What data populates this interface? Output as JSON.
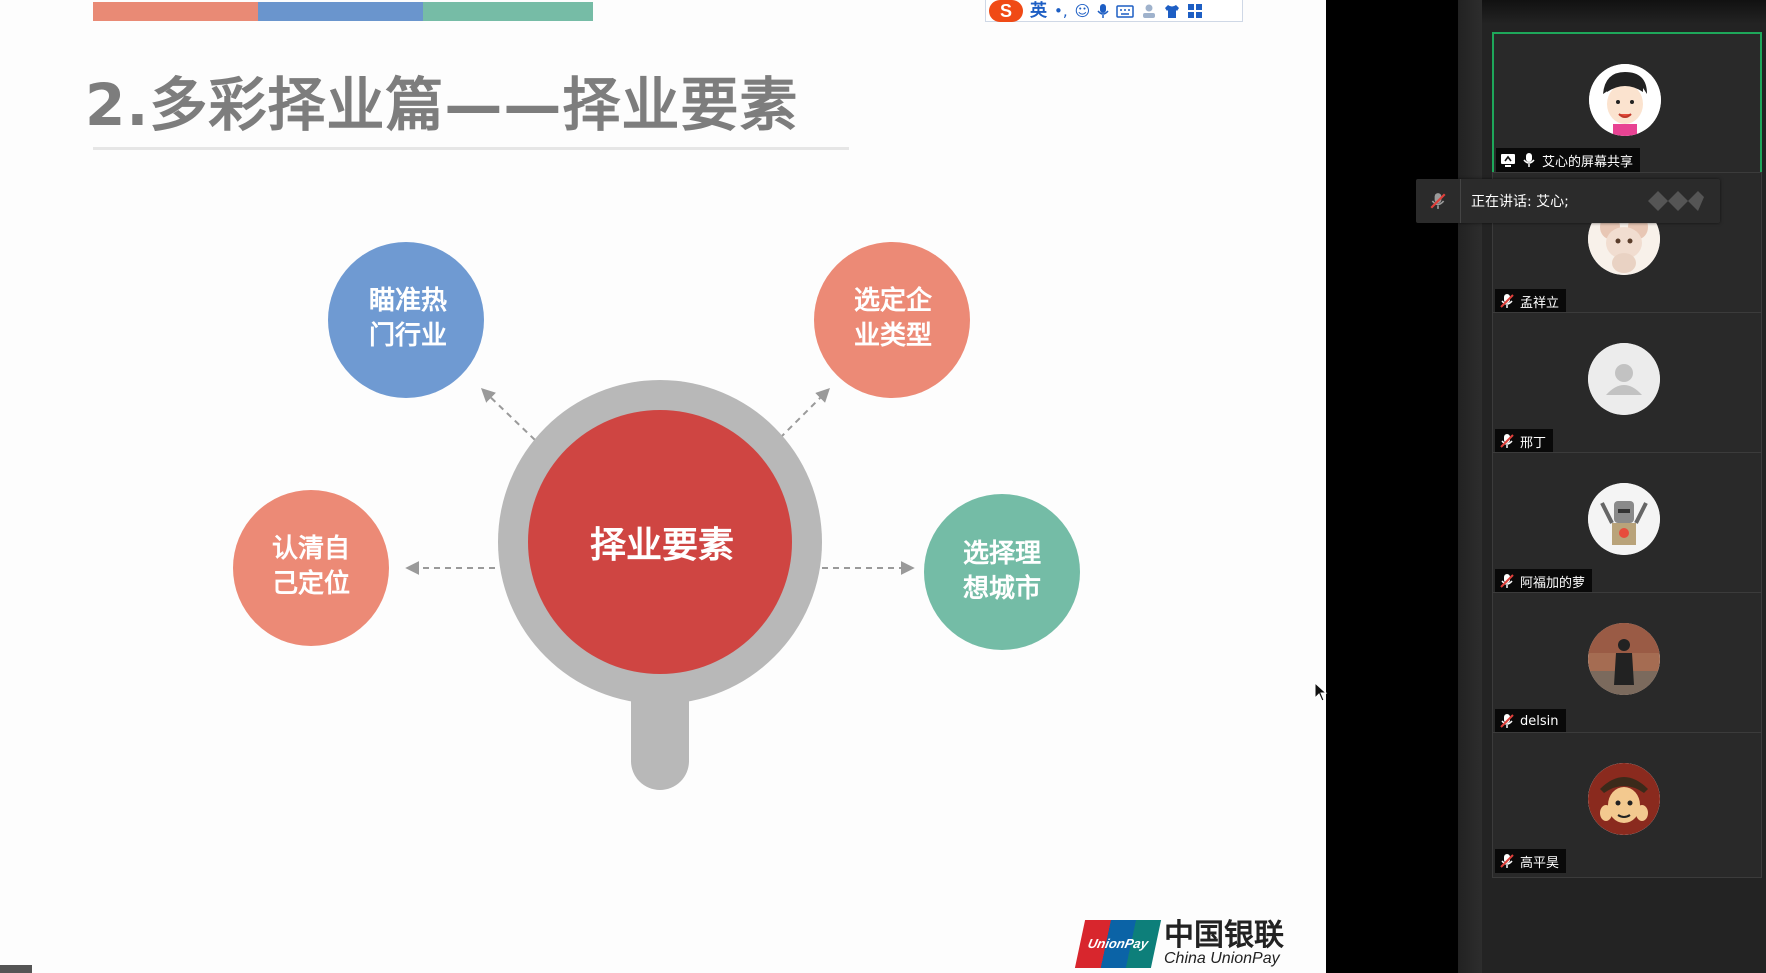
{
  "slide": {
    "title": "2.多彩择业篇——择业要素",
    "center_label": "择业要素",
    "nodes": {
      "top_left": [
        "瞄准热",
        "门行业"
      ],
      "top_right": [
        "选定企",
        "业类型"
      ],
      "left": [
        "认清自",
        "己定位"
      ],
      "right": [
        "选择理",
        "想城市"
      ]
    },
    "colors": {
      "blue": "#6f9ad2",
      "salmon": "#ec8a76",
      "teal": "#74bca6",
      "red": "#cf4542",
      "gray": "#b8b8b8"
    }
  },
  "ime_toolbar": {
    "logo": "S",
    "lang": "英",
    "punct": "•,",
    "icons": [
      "smiley-icon",
      "mic-icon",
      "keyboard-icon",
      "user-icon",
      "shirt-icon",
      "grid-icon"
    ]
  },
  "brand": {
    "badge_text": "UnionPay 银联",
    "cn": "中国银联",
    "en": "China UnionPay"
  },
  "speaker_banner": {
    "text": "正在讲话: 艾心;"
  },
  "participants": [
    {
      "name": "艾心的屏幕共享",
      "active": true,
      "icon": "screen-share-icon",
      "mic": "on"
    },
    {
      "name": "孟祥立",
      "active": false,
      "icon": null,
      "mic": "muted"
    },
    {
      "name": "邢丁",
      "active": false,
      "icon": null,
      "mic": "muted"
    },
    {
      "name": "阿福加的萝",
      "active": false,
      "icon": null,
      "mic": "muted"
    },
    {
      "name": "delsin",
      "active": false,
      "icon": null,
      "mic": "muted"
    },
    {
      "name": "高平昊",
      "active": false,
      "icon": null,
      "mic": "muted"
    }
  ]
}
